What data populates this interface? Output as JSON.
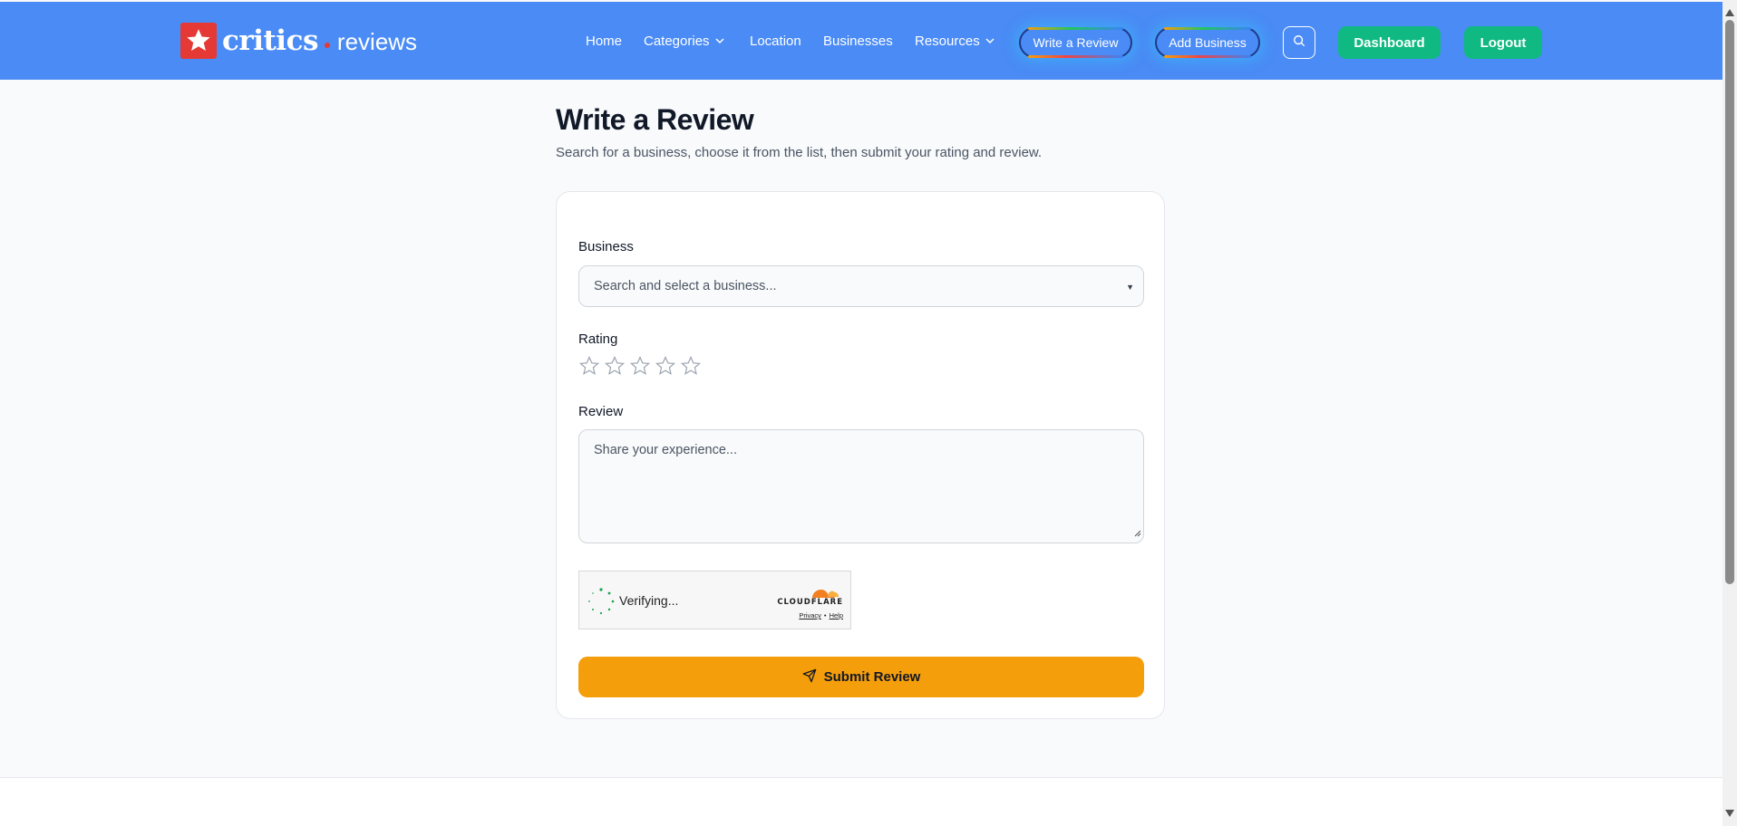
{
  "header": {
    "logo": {
      "brand": "critics",
      "suffix": "reviews"
    },
    "nav": {
      "home": "Home",
      "categories": "Categories",
      "location": "Location",
      "businesses": "Businesses",
      "resources": "Resources"
    },
    "write_review": "Write a Review",
    "add_business": "Add Business",
    "dashboard": "Dashboard",
    "logout": "Logout",
    "colors": {
      "bar": "#4a8bf5",
      "green": "#10b981",
      "logo_red": "#e53935"
    }
  },
  "main": {
    "title": "Write a Review",
    "subtitle": "Search for a business, choose it from the list, then submit your rating and review.",
    "form": {
      "business_label": "Business",
      "business_placeholder": "Search and select a business...",
      "rating_label": "Rating",
      "rating_value": 0,
      "rating_max": 5,
      "review_label": "Review",
      "review_placeholder": "Share your experience...",
      "captcha": {
        "status": "Verifying...",
        "brand": "CLOUDFLARE",
        "privacy": "Privacy",
        "separator": "•",
        "help": "Help"
      },
      "submit_label": "Submit Review",
      "submit_color": "#f59e0b"
    }
  }
}
